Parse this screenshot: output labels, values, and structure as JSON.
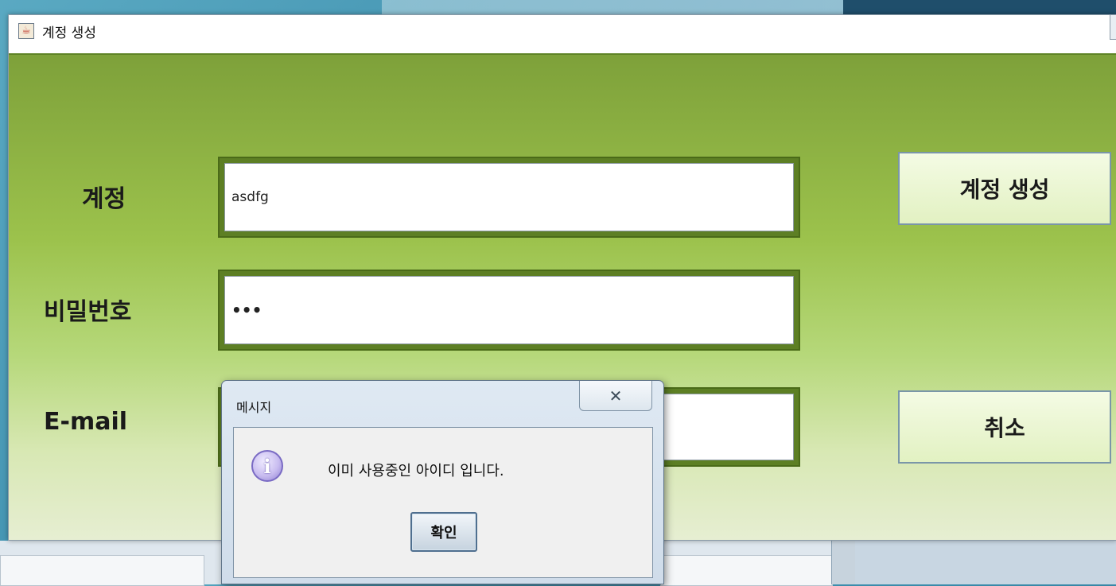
{
  "window": {
    "title": "계정 생성",
    "icon": "java-cup-icon"
  },
  "form": {
    "account_label": "계정",
    "account_value": "asdfg",
    "password_label": "비밀번호",
    "password_value": "•••",
    "email_label": "E-mail",
    "email_value": ""
  },
  "buttons": {
    "create_label": "계정 생성",
    "cancel_label": "취소"
  },
  "dialog": {
    "title": "메시지",
    "close_symbol": "✕",
    "icon": "info-icon",
    "icon_glyph": "i",
    "message": "이미 사용중인 아이디 입니다.",
    "ok_label": "확인"
  }
}
